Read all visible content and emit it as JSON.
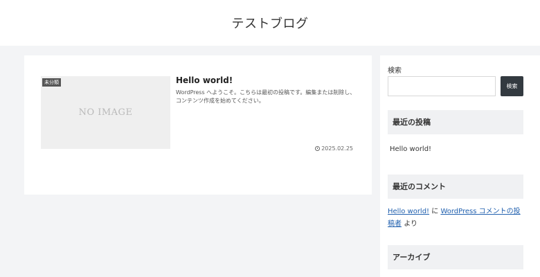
{
  "site": {
    "title": "テストブログ"
  },
  "post": {
    "category": "未分類",
    "thumbnail_text": "NO IMAGE",
    "title": "Hello world!",
    "excerpt": "WordPress へようこそ。こちらは最初の投稿です。編集または削除し、コンテンツ作成を始めてください。",
    "date": "2025.02.25"
  },
  "sidebar": {
    "search": {
      "label": "検索",
      "button": "検索",
      "value": ""
    },
    "recent_posts": {
      "heading": "最近の投稿",
      "items": [
        "Hello world!"
      ]
    },
    "recent_comments": {
      "heading": "最近のコメント",
      "post_link": "Hello world!",
      "connector": "に",
      "author_link": "WordPress コメントの投稿者",
      "suffix": "より"
    },
    "archive": {
      "heading": "アーカイブ"
    }
  }
}
